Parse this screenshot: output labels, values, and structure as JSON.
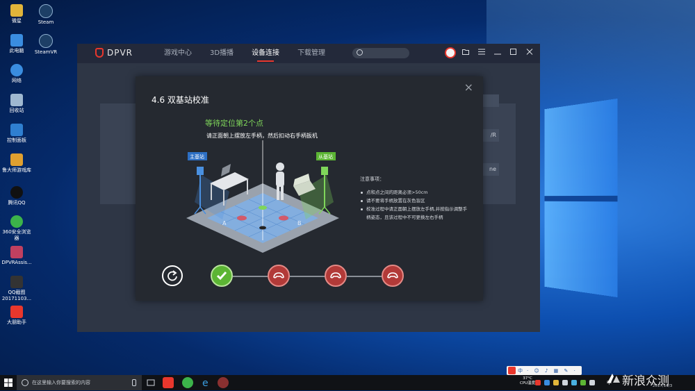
{
  "desktop": {
    "icons": [
      {
        "label": "微星",
        "color": "#e0b43a"
      },
      {
        "label": "Steam",
        "color": "#1b2838"
      },
      {
        "label": "此电脑",
        "color": "#3a8de0"
      },
      {
        "label": "SteamVR",
        "color": "#1b2838"
      },
      {
        "label": "网络",
        "color": "#3a8de0"
      },
      {
        "label": "回收站",
        "color": "#9fb8d0"
      },
      {
        "label": "控制面板",
        "color": "#2f7fd0"
      },
      {
        "label": "鲁大师游戏库",
        "color": "#e0a030"
      },
      {
        "label": "腾讯QQ",
        "color": "#111111"
      },
      {
        "label": "360安全浏览器",
        "color": "#3cb34a"
      },
      {
        "label": "DPVRAssis...",
        "color": "#c04060"
      },
      {
        "label": "QQ截图20171103...",
        "color": "#333333"
      },
      {
        "label": "大朋助手",
        "color": "#e8372d"
      }
    ]
  },
  "app": {
    "logo_text": "DPVR",
    "nav": [
      "游戏中心",
      "3D播播",
      "设备连接",
      "下载管理"
    ],
    "active_nav": "设备连接",
    "bg_buttons": [
      "",
      "/R",
      "ne"
    ],
    "accent_color": "#e8372d"
  },
  "modal": {
    "title": "4.6 双基站校准",
    "close_symbol": "×",
    "step_title": "等待定位第2个点",
    "instruction": "请正面朝上摆放左手柄，然后扣动右手柄扳机",
    "scene_labels": {
      "main_station": "主基站",
      "sub_station": "从基站",
      "point_a": "A",
      "point_b": "B"
    },
    "notes_title": "注意事项：",
    "notes": [
      "点和点之间的距离必须>50cm",
      "请不要将手柄放置在灰色盲区",
      "校准过程中请正面朝上摆放左手柄,并按指示调整手柄姿态，且该过程中不可更换左右手柄"
    ],
    "steps": [
      {
        "status": "done",
        "icon": "check-icon"
      },
      {
        "status": "todo",
        "icon": "controller-icon"
      },
      {
        "status": "todo",
        "icon": "controller-icon"
      },
      {
        "status": "todo",
        "icon": "controller-icon"
      }
    ],
    "colors": {
      "done": "#5cb534",
      "todo": "#b23a38",
      "highlight": "#7fd65a"
    }
  },
  "taskbar": {
    "search_placeholder": "在这里输入你要搜索的内容",
    "ime_text": "中",
    "temp_value": "37°C",
    "temp_label": "CPU温度",
    "clock": "2017/11/3",
    "tray_ime": "中"
  },
  "watermark": {
    "text": "新浪众测"
  }
}
